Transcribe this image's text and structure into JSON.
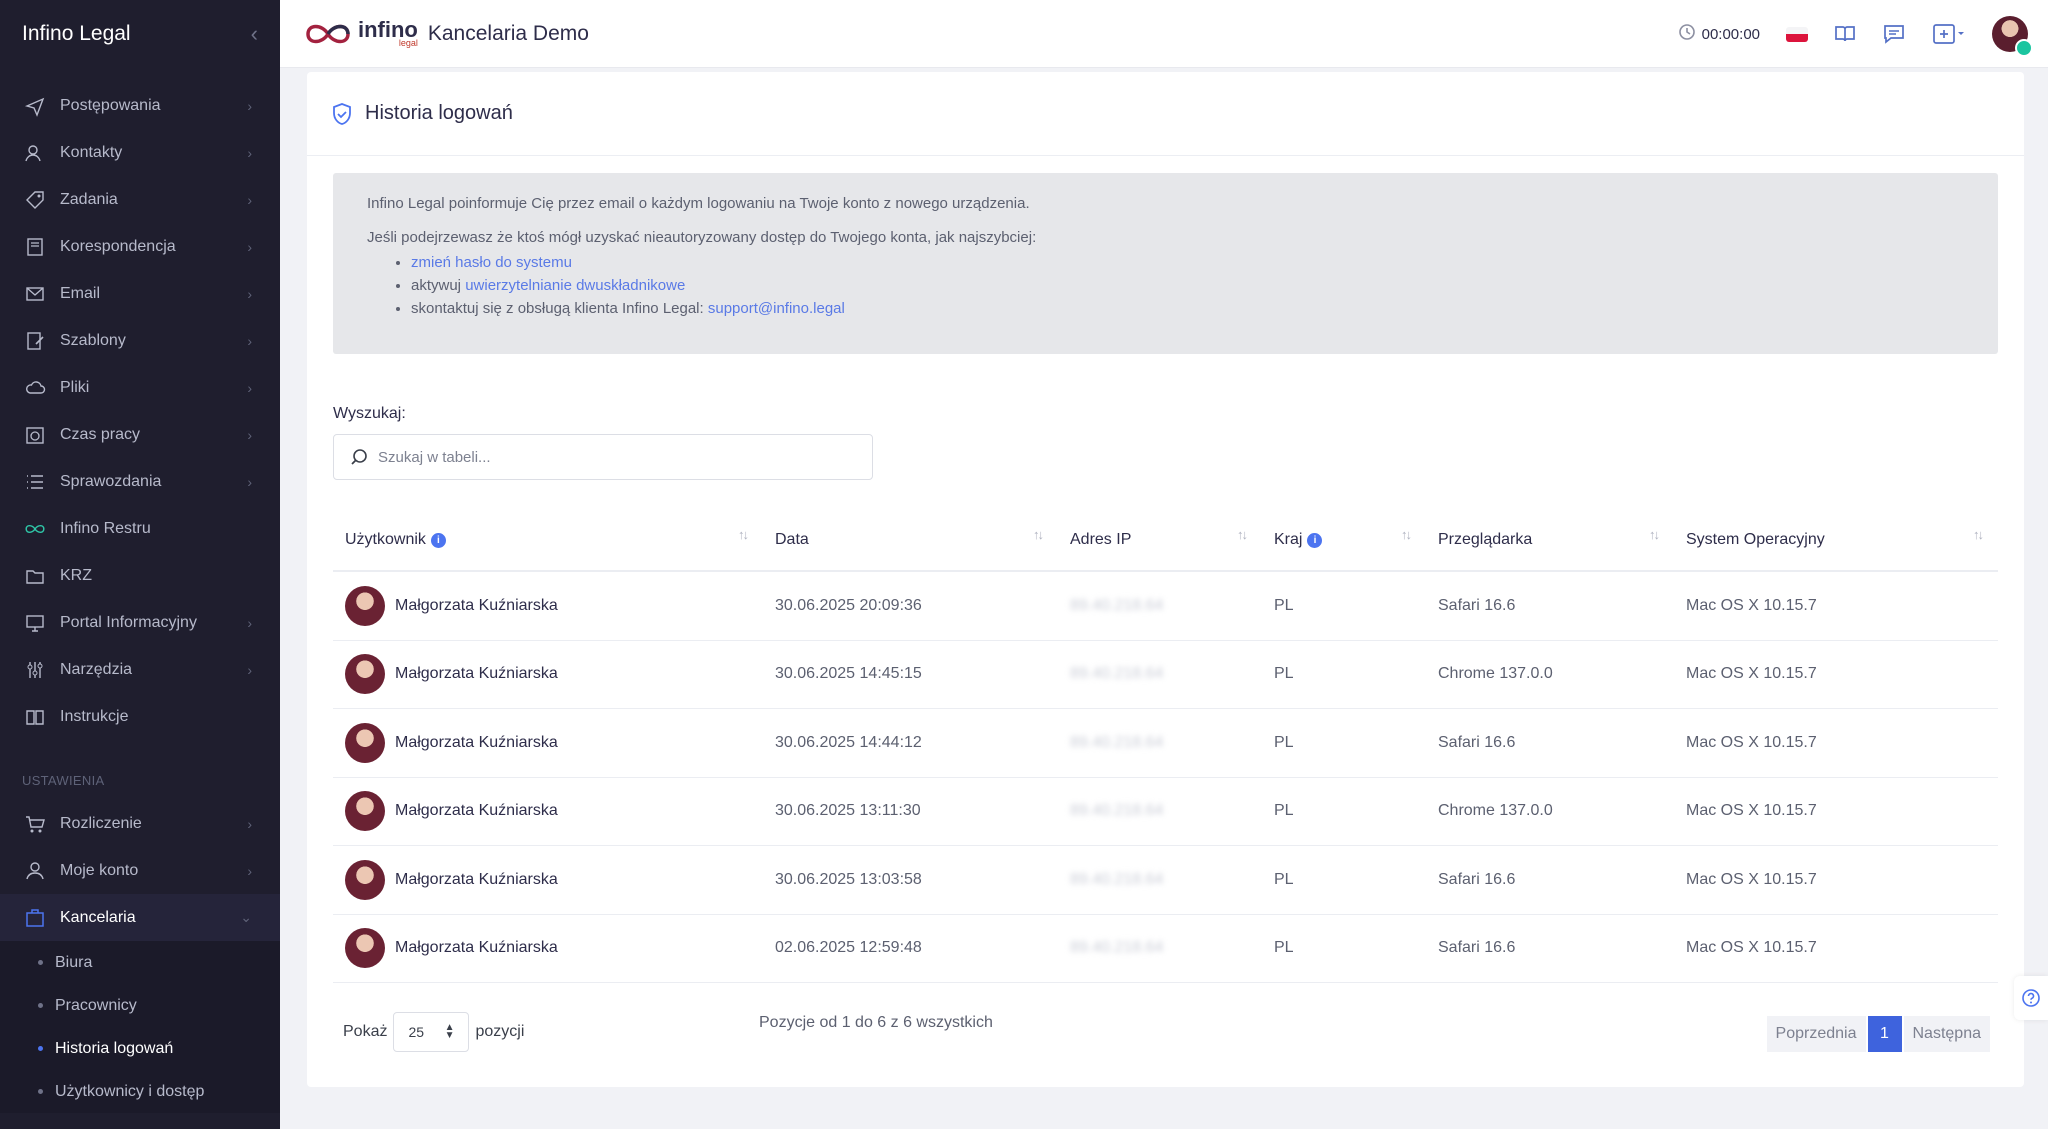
{
  "sidebar": {
    "brand": "Infino Legal",
    "items": [
      {
        "label": "Postępowania",
        "icon": "send-icon",
        "arrow": true
      },
      {
        "label": "Kontakty",
        "icon": "contacts-icon",
        "arrow": true
      },
      {
        "label": "Zadania",
        "icon": "tag-icon",
        "arrow": true
      },
      {
        "label": "Korespondencja",
        "icon": "book-icon",
        "arrow": true
      },
      {
        "label": "Email",
        "icon": "mail-icon",
        "arrow": true
      },
      {
        "label": "Szablony",
        "icon": "edit-doc-icon",
        "arrow": true
      },
      {
        "label": "Pliki",
        "icon": "cloud-icon",
        "arrow": true
      },
      {
        "label": "Czas pracy",
        "icon": "calendar-clock-icon",
        "arrow": true
      },
      {
        "label": "Sprawozdania",
        "icon": "list-icon",
        "arrow": true
      },
      {
        "label": "Infino Restru",
        "icon": "infinity-icon",
        "arrow": false
      },
      {
        "label": "KRZ",
        "icon": "folder-icon",
        "arrow": false
      },
      {
        "label": "Portal Informacyjny",
        "icon": "monitor-icon",
        "arrow": true
      },
      {
        "label": "Narzędzia",
        "icon": "sliders-icon",
        "arrow": true
      },
      {
        "label": "Instrukcje",
        "icon": "open-book-icon",
        "arrow": false
      }
    ],
    "section_label": "USTAWIENIA",
    "settings_items": [
      {
        "label": "Rozliczenie",
        "icon": "cart-icon"
      },
      {
        "label": "Moje konto",
        "icon": "user-icon"
      },
      {
        "label": "Kancelaria",
        "icon": "briefcase-icon"
      }
    ],
    "sub_items": [
      "Biura",
      "Pracownicy",
      "Historia logowań",
      "Użytkownicy i dostęp"
    ]
  },
  "header": {
    "logo_main": "infino",
    "logo_sub": "legal",
    "company": "Kancelaria Demo",
    "timer": "00:00:00"
  },
  "page": {
    "title": "Historia logowań",
    "notice": {
      "line1": "Infino Legal poinformuje Cię przez email o każdym logowaniu na Twoje konto z nowego urządzenia.",
      "line2": "Jeśli podejrzewasz że ktoś mógł uzyskać nieautoryzowany dostęp do Twojego konta, jak najszybciej:",
      "b1_link": "zmień hasło do systemu",
      "b2_prefix": "aktywuj ",
      "b2_link": "uwierzytelnianie dwuskładnikowe",
      "b3_prefix": "skontaktuj się z obsługą klienta Infino Legal: ",
      "b3_link": "support@infino.legal"
    },
    "search": {
      "label": "Wyszukaj:",
      "placeholder": "Szukaj w tabeli..."
    },
    "columns": [
      "Użytkownik",
      "Data",
      "Adres IP",
      "Kraj",
      "Przeglądarka",
      "System Operacyjny"
    ],
    "rows": [
      {
        "user": "Małgorzata Kuźniarska",
        "date": "30.06.2025 20:09:36",
        "ip": "89.40.218.64",
        "country": "PL",
        "browser": "Safari 16.6",
        "os": "Mac OS X 10.15.7"
      },
      {
        "user": "Małgorzata Kuźniarska",
        "date": "30.06.2025 14:45:15",
        "ip": "89.40.218.64",
        "country": "PL",
        "browser": "Chrome 137.0.0",
        "os": "Mac OS X 10.15.7"
      },
      {
        "user": "Małgorzata Kuźniarska",
        "date": "30.06.2025 14:44:12",
        "ip": "89.40.218.64",
        "country": "PL",
        "browser": "Safari 16.6",
        "os": "Mac OS X 10.15.7"
      },
      {
        "user": "Małgorzata Kuźniarska",
        "date": "30.06.2025 13:11:30",
        "ip": "89.40.218.64",
        "country": "PL",
        "browser": "Chrome 137.0.0",
        "os": "Mac OS X 10.15.7"
      },
      {
        "user": "Małgorzata Kuźniarska",
        "date": "30.06.2025 13:03:58",
        "ip": "89.40.218.64",
        "country": "PL",
        "browser": "Safari 16.6",
        "os": "Mac OS X 10.15.7"
      },
      {
        "user": "Małgorzata Kuźniarska",
        "date": "02.06.2025 12:59:48",
        "ip": "89.40.218.64",
        "country": "PL",
        "browser": "Safari 16.6",
        "os": "Mac OS X 10.15.7"
      }
    ],
    "footer": {
      "show_label": "Pokaż",
      "page_size": "25",
      "items_label": "pozycji",
      "info": "Pozycje od 1 do 6 z 6 wszystkich",
      "prev": "Poprzednia",
      "current_page": "1",
      "next": "Następna"
    }
  },
  "colors": {
    "sidebar_bg": "#1f1e2e",
    "accent": "#4c74f0",
    "link": "#5a7ae6"
  }
}
